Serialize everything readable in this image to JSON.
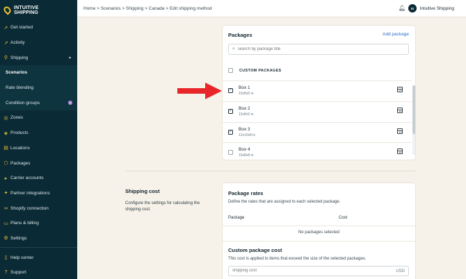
{
  "brand": {
    "line1": "INTUITIVE",
    "line2": "SHIPPING"
  },
  "breadcrumb": "Home > Scenarios > Shipping > Canada > Edit shipping method",
  "user": {
    "initials": "IS",
    "name": "Intuitive Shipping"
  },
  "sidebar": {
    "items": [
      {
        "label": "Get started",
        "icon": "rocket-icon"
      },
      {
        "label": "Activity",
        "icon": "chart-icon"
      },
      {
        "label": "Shipping",
        "icon": "map-pin-icon",
        "expanded": true
      },
      {
        "label": "Scenarios",
        "sub": true,
        "active": true
      },
      {
        "label": "Rate blending",
        "sub": true
      },
      {
        "label": "Condition groups",
        "sub": true,
        "badge": "i"
      },
      {
        "label": "Zones",
        "icon": "globe-icon"
      },
      {
        "label": "Products",
        "icon": "tag-icon"
      },
      {
        "label": "Locations",
        "icon": "store-icon"
      },
      {
        "label": "Packages",
        "icon": "box-icon"
      },
      {
        "label": "Carrier accounts",
        "icon": "truck-icon"
      },
      {
        "label": "Partner integrations",
        "icon": "puzzle-icon"
      },
      {
        "label": "Shopify connection",
        "icon": "link-icon"
      },
      {
        "label": "Plans & billing",
        "icon": "card-icon"
      },
      {
        "label": "Settings",
        "icon": "gear-icon"
      }
    ],
    "footer": [
      {
        "label": "Help center",
        "icon": "book-icon"
      },
      {
        "label": "Support",
        "icon": "help-icon"
      }
    ]
  },
  "packages": {
    "title": "Packages",
    "add_label": "Add package",
    "search_placeholder": "search by package title",
    "group_label": "CUSTOM PACKAGES",
    "rows": [
      {
        "name": "Box 1",
        "dims": "10x8x5 in",
        "checked": true
      },
      {
        "name": "Box 2",
        "dims": "12x8x5 in",
        "checked": true
      },
      {
        "name": "Box 3",
        "dims": "12x10x8 in",
        "checked": true
      },
      {
        "name": "Box 4",
        "dims": "15x8x8 in",
        "checked": false
      }
    ]
  },
  "shipping_cost": {
    "title": "Shipping cost",
    "description": "Configure the settings for calculating the shipping cost."
  },
  "package_rates": {
    "title": "Package rates",
    "description": "Define the rates that are assigned to each selected package.",
    "col_package": "Package",
    "col_cost": "Cost",
    "empty": "No packages selected"
  },
  "custom_package_cost": {
    "title": "Custom package cost",
    "description": "This cost is applied to items that exceed the size of the selected packages.",
    "placeholder": "shipping cost",
    "currency": "USD"
  },
  "colors": {
    "sidebar": "#0a2a35",
    "accent": "#f2c230",
    "link": "#2f6fc7",
    "arrow": "#e8262a"
  }
}
